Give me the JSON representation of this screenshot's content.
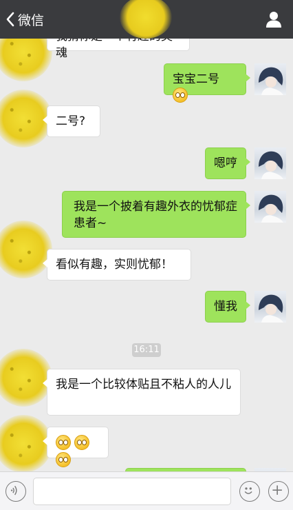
{
  "header": {
    "back_label": "微信"
  },
  "messages": [
    {
      "side": "left",
      "text": "我猜你是一个有趣的灵魂"
    },
    {
      "side": "right",
      "text": "宝宝二号"
    },
    {
      "side": "left",
      "text": "二号?"
    },
    {
      "side": "right",
      "text": "嗯哼"
    },
    {
      "side": "right",
      "text": "我是一个披着有趣外衣的忧郁症患者~"
    },
    {
      "side": "left",
      "text": "看似有趣，实则忧郁！"
    },
    {
      "side": "right",
      "text": "懂我"
    },
    {
      "side": "left",
      "text": "我是一个比较体贴且不粘人的人儿"
    }
  ],
  "timestamp": "16:11",
  "icons": {
    "back": "chevron-left-icon",
    "profile": "person-icon",
    "voice": "voice-icon",
    "emoji": "smiley-icon",
    "plus": "plus-icon"
  },
  "colors": {
    "header_bg": "#3a3b3e",
    "chat_bg": "#ebebeb",
    "my_bubble": "#9ee35c",
    "their_bubble": "#ffffff",
    "avatar_blur": "#e8cc1f"
  }
}
